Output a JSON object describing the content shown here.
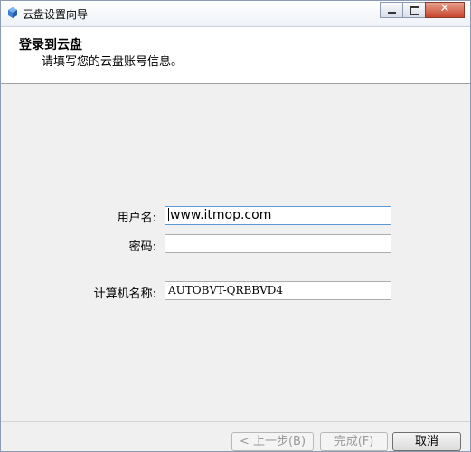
{
  "window": {
    "title": "云盘设置向导"
  },
  "header": {
    "title": "登录到云盘",
    "subtitle": "请填写您的云盘账号信息。"
  },
  "form": {
    "username_label": "用户名:",
    "username_value": "www.itmop.com",
    "password_label": "密码:",
    "password_value": "",
    "computer_label": "计算机名称:",
    "computer_value": "AUTOBVT-QRBBVD4"
  },
  "buttons": {
    "back": "< 上一步(B)",
    "finish": "完成(F)",
    "cancel": "取消"
  },
  "icons": {
    "app": "cloud-disk-icon",
    "minimize": "minimize-icon",
    "maximize": "maximize-icon",
    "close": "close-icon"
  }
}
